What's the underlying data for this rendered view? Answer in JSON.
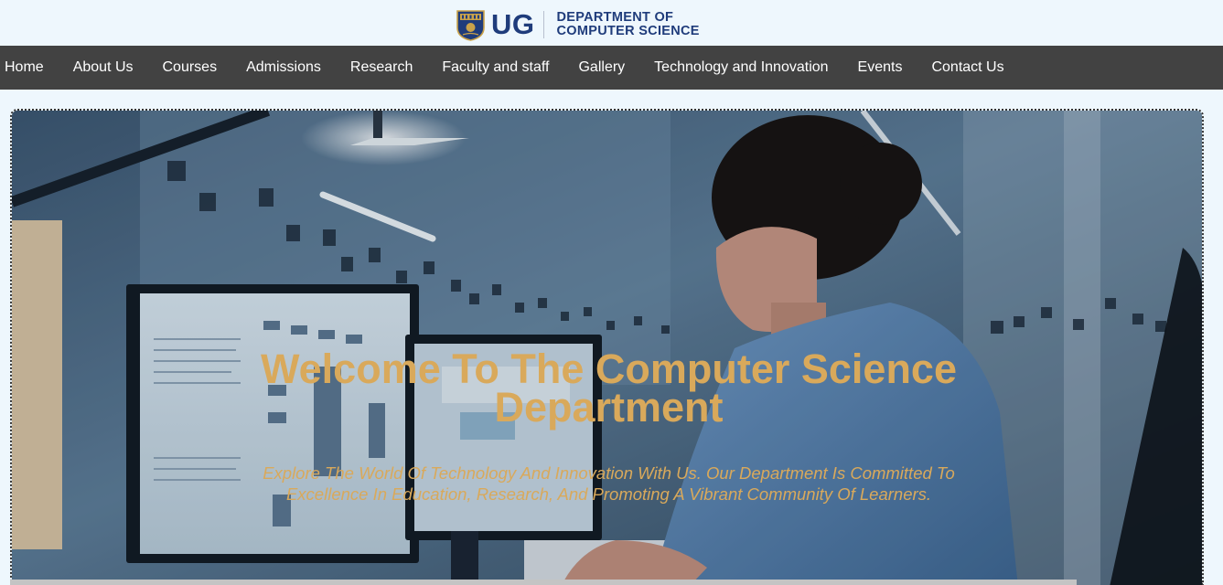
{
  "header": {
    "logo_abbrev": "UG",
    "dept_line1": "DEPARTMENT OF",
    "dept_line2": "COMPUTER SCIENCE"
  },
  "nav": {
    "items": [
      {
        "label": "Home"
      },
      {
        "label": "About Us"
      },
      {
        "label": "Courses"
      },
      {
        "label": "Admissions"
      },
      {
        "label": "Research"
      },
      {
        "label": "Faculty and staff"
      },
      {
        "label": "Gallery"
      },
      {
        "label": "Technology and Innovation"
      },
      {
        "label": "Events"
      },
      {
        "label": "Contact Us"
      }
    ]
  },
  "hero": {
    "title": "Welcome To The Computer Science Department",
    "subtitle": "Explore The World Of Technology And Innovation With Us. Our Department Is Committed To Excellence In Education, Research, And Promoting A Vibrant Community Of Learners."
  },
  "colors": {
    "brand_blue": "#1f3c7b",
    "nav_bg": "#424242",
    "hero_text": "#d9a95b",
    "page_bg": "#eef7fd"
  },
  "icons": {
    "crest": "ug-crest-icon"
  }
}
